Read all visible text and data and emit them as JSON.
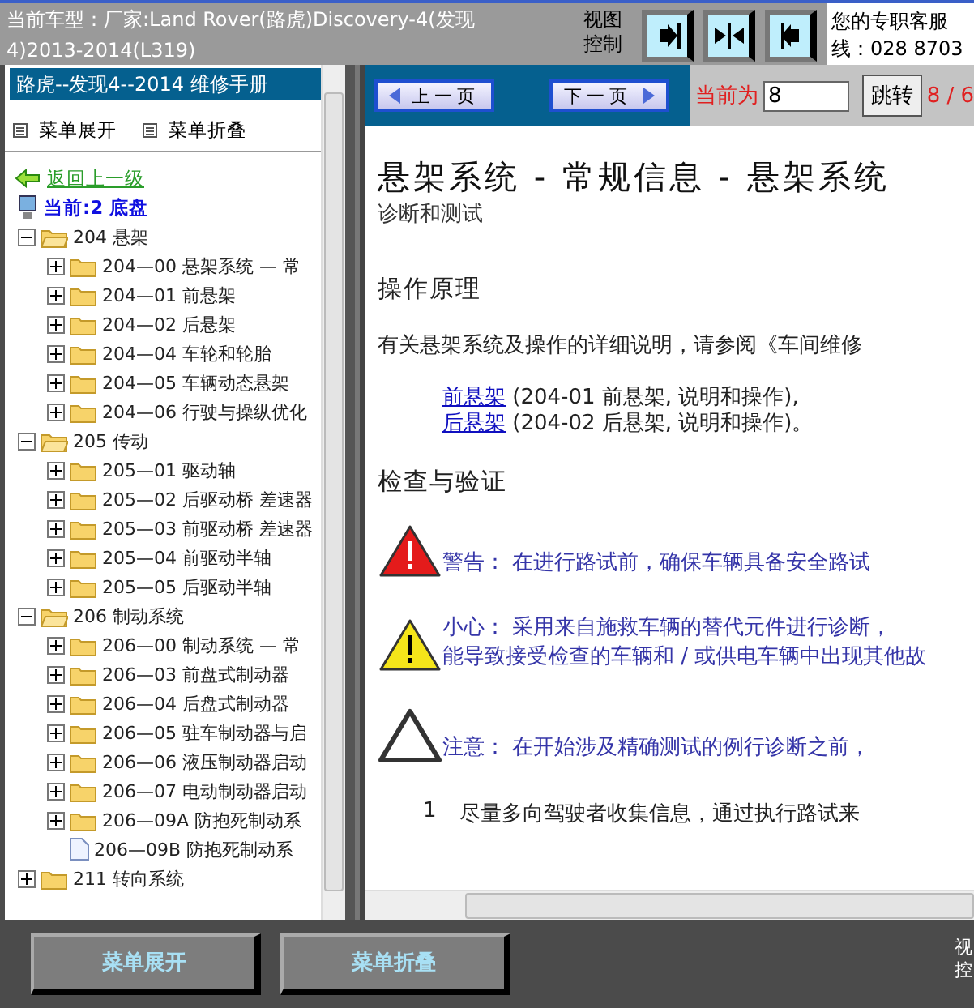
{
  "header": {
    "title": "当前车型：厂家:Land Rover(路虎)Discovery-4(发现4)2013-2014(L319)",
    "view_control_label": "视图控制",
    "view_buttons": [
      {
        "kind": "right"
      },
      {
        "kind": "center"
      },
      {
        "kind": "left"
      }
    ],
    "support_lines": [
      "您的专职客服",
      "线：028 8703"
    ]
  },
  "sidebar": {
    "title": "路虎--发现4--2014 维修手册",
    "actions": [
      "菜单展开",
      "菜单折叠"
    ],
    "back_link": "返回上一级",
    "current": "当前:2 底盘",
    "tree": [
      {
        "kind": "folder",
        "label": "204 悬架",
        "expanded": true,
        "children": [
          {
            "kind": "folder",
            "label": "204—00 悬架系统 — 常",
            "expanded": false
          },
          {
            "kind": "folder",
            "label": "204—01 前悬架",
            "expanded": false
          },
          {
            "kind": "folder",
            "label": "204—02 后悬架",
            "expanded": false
          },
          {
            "kind": "folder",
            "label": "204—04 车轮和轮胎",
            "expanded": false
          },
          {
            "kind": "folder",
            "label": "204—05 车辆动态悬架",
            "expanded": false
          },
          {
            "kind": "folder",
            "label": "204—06 行驶与操纵优化",
            "expanded": false
          }
        ]
      },
      {
        "kind": "folder",
        "label": "205 传动",
        "expanded": true,
        "children": [
          {
            "kind": "folder",
            "label": "205—01 驱动轴",
            "expanded": false
          },
          {
            "kind": "folder",
            "label": "205—02 后驱动桥 差速器",
            "expanded": false
          },
          {
            "kind": "folder",
            "label": "205—03 前驱动桥 差速器",
            "expanded": false
          },
          {
            "kind": "folder",
            "label": "205—04 前驱动半轴",
            "expanded": false
          },
          {
            "kind": "folder",
            "label": "205—05 后驱动半轴",
            "expanded": false
          }
        ]
      },
      {
        "kind": "folder",
        "label": "206 制动系统",
        "expanded": true,
        "children": [
          {
            "kind": "folder",
            "label": "206—00 制动系统 — 常",
            "expanded": false
          },
          {
            "kind": "folder",
            "label": "206—03 前盘式制动器",
            "expanded": false
          },
          {
            "kind": "folder",
            "label": "206—04 后盘式制动器",
            "expanded": false
          },
          {
            "kind": "folder",
            "label": "206—05 驻车制动器与启",
            "expanded": false
          },
          {
            "kind": "folder",
            "label": "206—06 液压制动器启动",
            "expanded": false
          },
          {
            "kind": "folder",
            "label": "206—07 电动制动器启动",
            "expanded": false
          },
          {
            "kind": "folder",
            "label": "206—09A 防抱死制动系",
            "expanded": false
          },
          {
            "kind": "document",
            "label": "206—09B 防抱死制动系"
          }
        ]
      },
      {
        "kind": "folder",
        "label": "211 转向系统",
        "expanded": false
      }
    ]
  },
  "toolbar": {
    "prev": "上一页",
    "next": "下一页",
    "current_label": "当前为",
    "page_value": "8",
    "jump": "跳转",
    "page_count": "8 / 6"
  },
  "content": {
    "title": "悬架系统 - 常规信息 - 悬架系统",
    "subtitle": "诊断和测试",
    "blocks": [
      {
        "kind": "heading",
        "text": "操作原理"
      },
      {
        "kind": "paragraph",
        "text": "有关悬架系统及操作的详细说明，请参阅《车间维修"
      },
      {
        "kind": "link_line",
        "link": "前悬架",
        "text": " (204-01 前悬架, 说明和操作),"
      },
      {
        "kind": "link_line",
        "link": "后悬架",
        "text": " (204-02 后悬架, 说明和操作)。"
      },
      {
        "kind": "heading",
        "text": "检查与验证"
      },
      {
        "kind": "warning",
        "text": "警告：  在进行路试前，确保车辆具备安全路试"
      },
      {
        "kind": "caution",
        "text": "小心：  采用来自施救车辆的替代元件进行诊断，",
        "more": "能导致接受检查的车辆和 / 或供电车辆中出现其他故"
      },
      {
        "kind": "note",
        "text": "注意：  在开始涉及精确测试的例行诊断之前，"
      },
      {
        "kind": "numbered",
        "number": "1",
        "text": "尽量多向驾驶者收集信息，通过执行路试来"
      }
    ]
  },
  "footer": {
    "buttons": [
      "菜单展开",
      "菜单折叠"
    ],
    "side_label": [
      "视",
      "控"
    ]
  }
}
